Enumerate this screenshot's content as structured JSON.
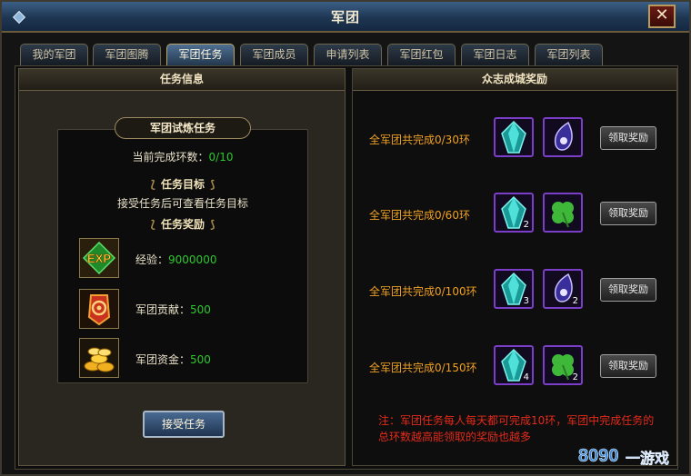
{
  "window": {
    "title": "军团",
    "close_icon": "close-icon"
  },
  "tabs": [
    {
      "label": "我的军团",
      "active": false
    },
    {
      "label": "军团图腾",
      "active": false
    },
    {
      "label": "军团任务",
      "active": true
    },
    {
      "label": "军团成员",
      "active": false
    },
    {
      "label": "申请列表",
      "active": false
    },
    {
      "label": "军团红包",
      "active": false
    },
    {
      "label": "军团日志",
      "active": false
    },
    {
      "label": "军团列表",
      "active": false
    }
  ],
  "task_info": {
    "header": "任务信息",
    "trial_title": "军团试炼任务",
    "progress_label": "当前完成环数：",
    "progress_value": "0/10",
    "goal_title": "任务目标",
    "goal_text": "接受任务后可查看任务目标",
    "reward_title": "任务奖励",
    "rewards": [
      {
        "icon": "exp-icon",
        "label": "经验：",
        "value": "9000000"
      },
      {
        "icon": "contribution-icon",
        "label": "军团贡献：",
        "value": "500"
      },
      {
        "icon": "gold-coins-icon",
        "label": "军团资金：",
        "value": "500"
      }
    ],
    "accept_button": "接受任务"
  },
  "city_rewards": {
    "header": "众志成城奖励",
    "tiers": [
      {
        "label": "全军团共完成0/30环",
        "items": [
          {
            "icon": "crystal-icon",
            "count": ""
          },
          {
            "icon": "purple-gem-icon",
            "count": ""
          }
        ],
        "button": "领取奖励"
      },
      {
        "label": "全军团共完成0/60环",
        "items": [
          {
            "icon": "crystal-icon",
            "count": "2"
          },
          {
            "icon": "clover-icon",
            "count": ""
          }
        ],
        "button": "领取奖励"
      },
      {
        "label": "全军团共完成0/100环",
        "items": [
          {
            "icon": "crystal-icon",
            "count": "3"
          },
          {
            "icon": "purple-gem-icon",
            "count": "2"
          }
        ],
        "button": "领取奖励"
      },
      {
        "label": "全军团共完成0/150环",
        "items": [
          {
            "icon": "crystal-icon",
            "count": "4"
          },
          {
            "icon": "clover-icon",
            "count": "2"
          }
        ],
        "button": "领取奖励"
      }
    ],
    "note": "注：军团任务每人每天都可完成10环，军团中完成任务的总环数越高能领取的奖励也越多"
  },
  "watermark": {
    "text": "8090",
    "sub": "一游戏"
  },
  "colors": {
    "tier_text": "#f0a020",
    "note_text": "#e42a1a",
    "progress_value": "#2ec82e",
    "item_border": "#7a3ec8"
  }
}
